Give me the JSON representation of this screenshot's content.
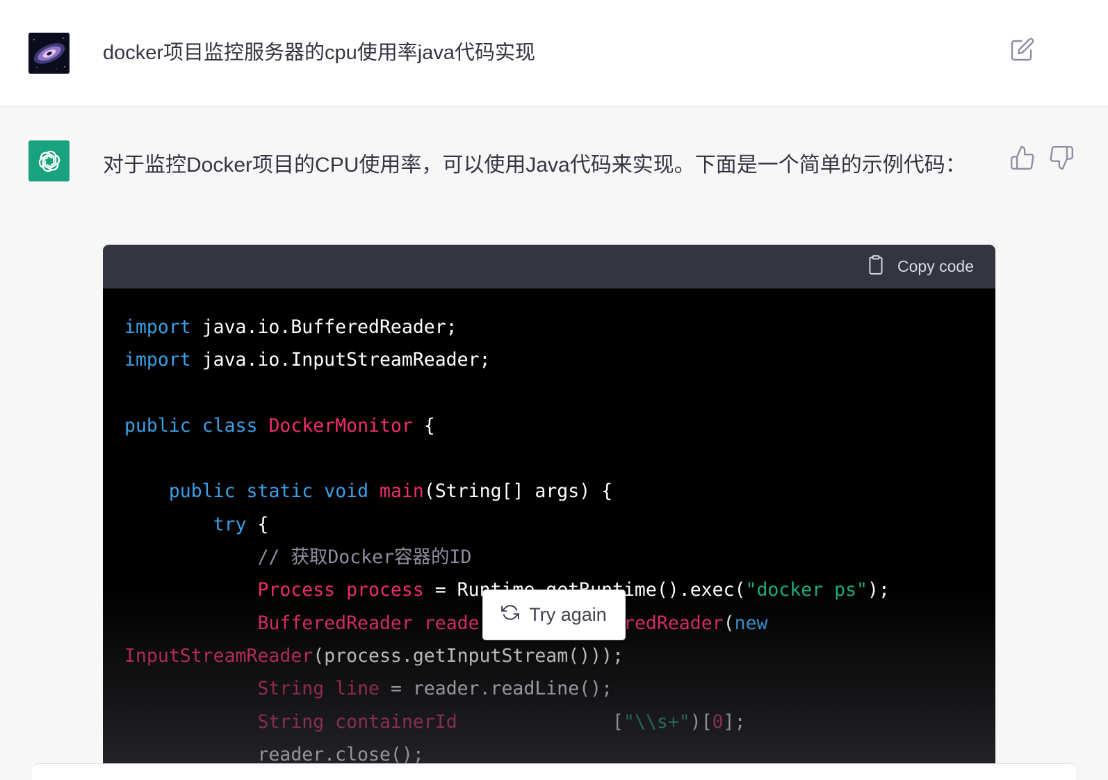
{
  "user_message": {
    "text": "docker项目监控服务器的cpu使用率java代码实现"
  },
  "assistant_message": {
    "intro": "对于监控Docker项目的CPU使用率，可以使用Java代码来实现。下面是一个简单的示例代码："
  },
  "code_block": {
    "copy_label": "Copy code",
    "lines": [
      [
        {
          "t": "import",
          "c": "kw"
        },
        {
          "t": " java.io.BufferedReader;",
          "c": ""
        }
      ],
      [
        {
          "t": "import",
          "c": "kw"
        },
        {
          "t": " java.io.InputStreamReader;",
          "c": ""
        }
      ],
      [],
      [
        {
          "t": "public",
          "c": "kw"
        },
        {
          "t": " ",
          "c": ""
        },
        {
          "t": "class",
          "c": "kw"
        },
        {
          "t": " ",
          "c": ""
        },
        {
          "t": "DockerMonitor",
          "c": "ty"
        },
        {
          "t": " {",
          "c": ""
        }
      ],
      [],
      [
        {
          "t": "    ",
          "c": ""
        },
        {
          "t": "public",
          "c": "kw"
        },
        {
          "t": " ",
          "c": ""
        },
        {
          "t": "static",
          "c": "kw"
        },
        {
          "t": " ",
          "c": ""
        },
        {
          "t": "void",
          "c": "kw"
        },
        {
          "t": " ",
          "c": ""
        },
        {
          "t": "main",
          "c": "ty"
        },
        {
          "t": "(String[] args) {",
          "c": ""
        }
      ],
      [
        {
          "t": "        ",
          "c": ""
        },
        {
          "t": "try",
          "c": "kw"
        },
        {
          "t": " {",
          "c": ""
        }
      ],
      [
        {
          "t": "            ",
          "c": ""
        },
        {
          "t": "// 获取Docker容器的ID",
          "c": "cm"
        }
      ],
      [
        {
          "t": "            ",
          "c": ""
        },
        {
          "t": "Process",
          "c": "ty"
        },
        {
          "t": " ",
          "c": ""
        },
        {
          "t": "process",
          "c": "ty"
        },
        {
          "t": " = Runtime.getRuntime().exec(",
          "c": ""
        },
        {
          "t": "\"docker ps\"",
          "c": "st"
        },
        {
          "t": ");",
          "c": ""
        }
      ],
      [
        {
          "t": "            ",
          "c": ""
        },
        {
          "t": "BufferedReader",
          "c": "ty"
        },
        {
          "t": " ",
          "c": ""
        },
        {
          "t": "reader",
          "c": "ty"
        },
        {
          "t": " = ",
          "c": ""
        },
        {
          "t": "new",
          "c": "kw"
        },
        {
          "t": " ",
          "c": ""
        },
        {
          "t": "BufferedReader",
          "c": "ty"
        },
        {
          "t": "(",
          "c": ""
        },
        {
          "t": "new",
          "c": "kw"
        }
      ],
      [
        {
          "t": "InputStreamReader",
          "c": "ty"
        },
        {
          "t": "(process.getInputStream()));",
          "c": ""
        }
      ],
      [
        {
          "t": "            ",
          "c": ""
        },
        {
          "t": "String",
          "c": "ty"
        },
        {
          "t": " ",
          "c": ""
        },
        {
          "t": "line",
          "c": "ty"
        },
        {
          "t": " = reader.readLine();",
          "c": ""
        }
      ],
      [
        {
          "t": "            ",
          "c": ""
        },
        {
          "t": "String",
          "c": "ty"
        },
        {
          "t": " ",
          "c": ""
        },
        {
          "t": "containerId",
          "c": "ty"
        },
        {
          "t": "              ",
          "c": ""
        },
        {
          "t": "[",
          "c": ""
        },
        {
          "t": "\"\\\\s+\"",
          "c": "st"
        },
        {
          "t": ")[",
          "c": ""
        },
        {
          "t": "0",
          "c": "ty"
        },
        {
          "t": "];",
          "c": ""
        }
      ],
      [
        {
          "t": "            ",
          "c": ""
        },
        {
          "t": "reader.close();",
          "c": ""
        }
      ]
    ]
  },
  "try_again_label": "Try again",
  "icons": {
    "edit": "edit-icon",
    "bot": "openai-logo-icon",
    "thumbs_up": "thumbs-up-icon",
    "thumbs_down": "thumbs-down-icon",
    "clipboard": "clipboard-icon",
    "refresh": "refresh-icon"
  },
  "colors": {
    "keyword": "#3aa0e8",
    "type": "#f22c6d",
    "string": "#1fad80",
    "comment": "#8e8ea0",
    "bot_avatar": "#19a27e"
  }
}
